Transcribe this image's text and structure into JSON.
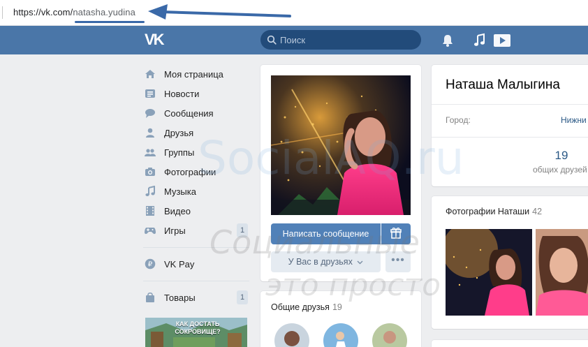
{
  "browser": {
    "url_host": "https://vk.com/",
    "url_path": "natasha.yudina"
  },
  "header": {
    "logo": "VK",
    "search_placeholder": "Поиск",
    "icons": [
      "bell-icon",
      "music-icon",
      "play-icon"
    ]
  },
  "menu": {
    "items": [
      {
        "label": "Моя страница",
        "icon": "home-icon"
      },
      {
        "label": "Новости",
        "icon": "news-icon"
      },
      {
        "label": "Сообщения",
        "icon": "messages-icon"
      },
      {
        "label": "Друзья",
        "icon": "friend-icon"
      },
      {
        "label": "Группы",
        "icon": "groups-icon"
      },
      {
        "label": "Фотографии",
        "icon": "camera-icon"
      },
      {
        "label": "Музыка",
        "icon": "music-note-icon"
      },
      {
        "label": "Видео",
        "icon": "film-icon"
      },
      {
        "label": "Игры",
        "icon": "gamepad-icon",
        "count": "1"
      }
    ],
    "pay": {
      "label": "VK Pay",
      "icon": "vkpay-icon"
    },
    "goods": {
      "label": "Товары",
      "icon": "bag-icon",
      "count": "1"
    },
    "ad_text": "КАК ДОСТАТЬ СОКРОВИЩЕ?"
  },
  "profile": {
    "send_message": "Написать сообщение",
    "friends_status": "У Вас в друзьях",
    "more": "•••",
    "common_friends_title": "Общие друзья",
    "common_friends_count": "19"
  },
  "info": {
    "name": "Наташа Малыгина",
    "city_label": "Город:",
    "city_value": "Нижни",
    "common_count": "19",
    "common_label": "общих друзей"
  },
  "photos": {
    "title": "Фотографии Наташи",
    "count": "42"
  },
  "watermark": {
    "line1": "SocialAQ.ru",
    "line2": "Социальные",
    "line3": "это просто"
  },
  "colors": {
    "vk_blue": "#4a76a8",
    "button_blue": "#5181b8",
    "link": "#2a5885",
    "annotation_arrow": "#3a69a8"
  }
}
